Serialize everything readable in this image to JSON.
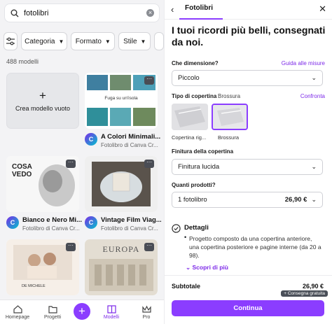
{
  "search": {
    "value": "fotolibri"
  },
  "filters": [
    "Categoria",
    "Formato",
    "Stile"
  ],
  "results_count": "488 modelli",
  "create_label": "Crea modello vuoto",
  "thumb_texts": {
    "fuga": "Fuga su un'isola",
    "cosa": "COSA",
    "vedo": "VEDO",
    "demichele": "DE MICHELE",
    "europa": "EUROPA"
  },
  "templates": [
    {
      "title": "A Colori Minimali...",
      "sub": "Fotolibro di Canva Cr..."
    },
    {
      "title": "Bianco e Nero Mi...",
      "sub": "Fotolibro di Canva Cr..."
    },
    {
      "title": "Vintage Film Viag...",
      "sub": "Fotolibro di Canva Cr..."
    }
  ],
  "more_label": "···",
  "logo_letter": "C",
  "nav": {
    "home": "Homepage",
    "projects": "Progetti",
    "models": "Modelli",
    "pro": "Pro"
  },
  "right": {
    "tab": "Fotolibri",
    "headline": "I tuoi ricordi più belli, consegnati da noi.",
    "size_label": "Che dimensione?",
    "size_guide": "Guida alle misure",
    "size_value": "Piccolo",
    "cover_label": "Tipo di copertina",
    "cover_value": "Brossura",
    "compare": "Confronta",
    "cover_options": [
      "Copertina rig...",
      "Brossura"
    ],
    "finish_label": "Finitura della copertina",
    "finish_value": "Finitura lucida",
    "qty_label": "Quanti prodotti?",
    "qty_value": "1 fotolibro",
    "qty_price": "26,90 €",
    "details_title": "Dettagli",
    "details_text": "Progetto composto da una copertina anteriore, una copertina posteriore e pagine interne (da 20 a 98).",
    "more": "Scopri di più",
    "subtotal_label": "Subtotale",
    "subtotal_value": "26,90 €",
    "shipping_badge": "+ Consegna gratuita",
    "cta": "Continua"
  },
  "colors": {
    "accent": "#8b3dff",
    "accent_text": "#7d2ae8"
  }
}
